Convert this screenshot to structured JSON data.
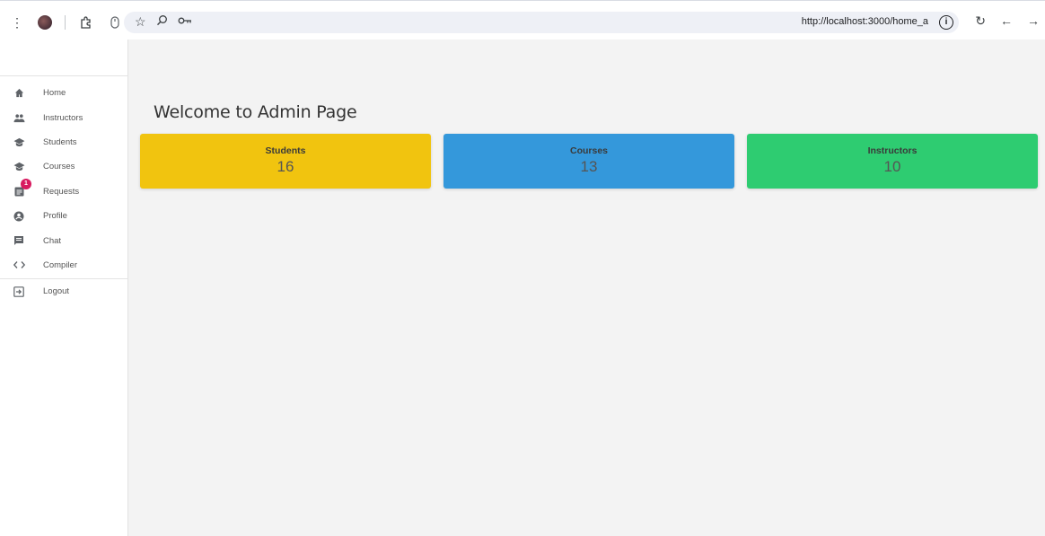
{
  "browser": {
    "url": "http://localhost:3000/home_a",
    "icons": [
      "more-vert-icon",
      "profile-avatar",
      "extensions-icon",
      "mouse-icon",
      "bookmark-star-icon",
      "zoom-icon",
      "password-key-icon",
      "site-info-icon",
      "reload-icon",
      "back-icon",
      "forward-icon"
    ]
  },
  "sidebar": {
    "items": [
      {
        "label": "Home",
        "icon": "home-icon"
      },
      {
        "label": "Instructors",
        "icon": "people-icon"
      },
      {
        "label": "Students",
        "icon": "school-icon"
      },
      {
        "label": "Courses",
        "icon": "school-icon"
      },
      {
        "label": "Requests",
        "icon": "assignment-icon",
        "badge": "1"
      },
      {
        "label": "Profile",
        "icon": "account-circle-icon"
      },
      {
        "label": "Chat",
        "icon": "chat-icon"
      },
      {
        "label": "Compiler",
        "icon": "code-icon"
      }
    ],
    "logout": {
      "label": "Logout",
      "icon": "logout-icon"
    }
  },
  "main": {
    "title": "Welcome to Admin Page",
    "cards": [
      {
        "label": "Students",
        "value": "16",
        "color": "#f1c40f"
      },
      {
        "label": "Courses",
        "value": "13",
        "color": "#3498db"
      },
      {
        "label": "Instructors",
        "value": "10",
        "color": "#2ecc71"
      }
    ]
  }
}
